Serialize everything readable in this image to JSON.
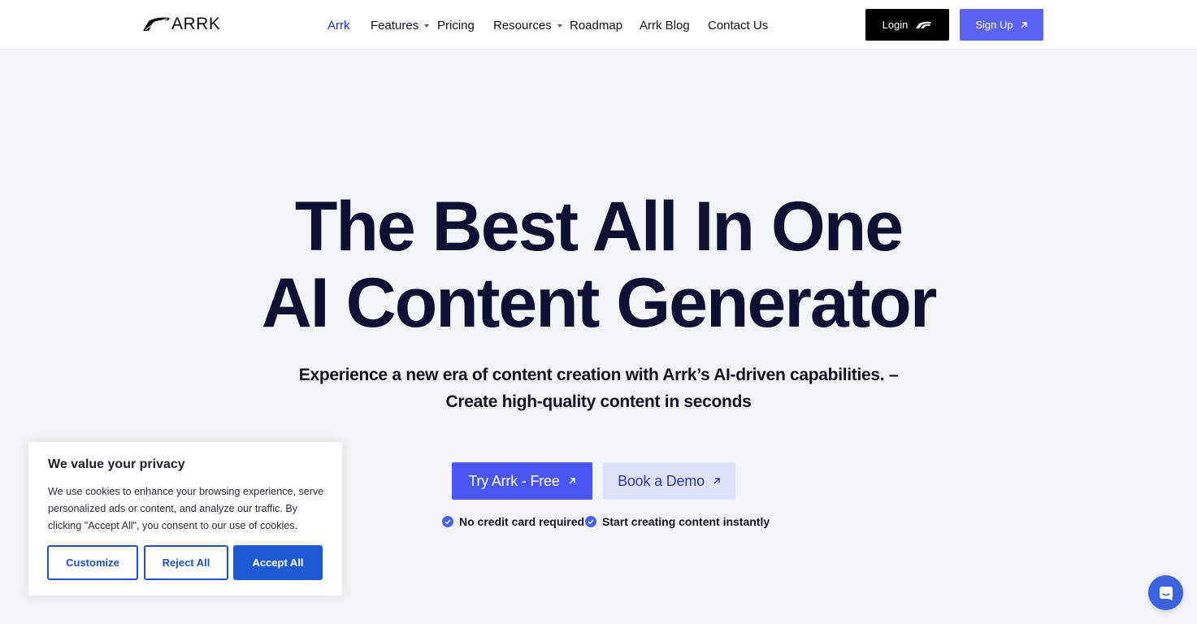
{
  "brand": {
    "logo_text": "ARRK"
  },
  "nav": {
    "items": [
      {
        "label": "Arrk",
        "dropdown": false,
        "active": true
      },
      {
        "label": "Features",
        "dropdown": true
      },
      {
        "label": "Pricing",
        "dropdown": false
      },
      {
        "label": "Resources",
        "dropdown": true
      },
      {
        "label": "Roadmap",
        "dropdown": false
      },
      {
        "label": "Arrk Blog",
        "dropdown": false
      },
      {
        "label": "Contact Us",
        "dropdown": false
      }
    ],
    "login_label": "Login",
    "login_icon": "arrk-mark-icon",
    "signup_label": "Sign Up",
    "signup_icon": "arrow-up-right-icon"
  },
  "hero": {
    "title_line1": "The Best All In One",
    "title_line2": "AI Content Generator",
    "subtitle_line1": "Experience a new era of content creation with Arrk’s AI-driven capabilities. –",
    "subtitle_line2": "Create high-quality content in seconds",
    "cta_primary": "Try Arrk - Free",
    "cta_secondary": "Book a Demo",
    "perks": [
      "No credit card required",
      "Start creating content instantly"
    ]
  },
  "cookie_banner": {
    "title": "We value your privacy",
    "body": "We use cookies to enhance your browsing experience, serve personalized ads or content, and analyze our traffic. By clicking \"Accept All\", you consent to our use of cookies.",
    "customize_label": "Customize",
    "reject_label": "Reject All",
    "accept_label": "Accept All"
  },
  "chat_widget": {
    "icon": "chat-bubble-icon"
  },
  "colors": {
    "page_bg": "#f3f4f7",
    "heading": "#0d0f33",
    "primary": "#4a56f2",
    "secondary_bg": "#dfe2fb",
    "cookie_accent": "#1d5ad4"
  }
}
